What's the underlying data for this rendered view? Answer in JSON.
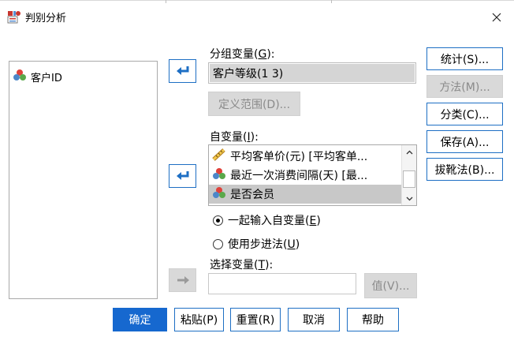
{
  "dialog": {
    "title": "判别分析"
  },
  "source_list": {
    "items": [
      {
        "label": "客户ID",
        "icon": "nominal-variable-icon"
      }
    ]
  },
  "grouping": {
    "label_text": "分组变量(",
    "label_key": "G",
    "label_tail": "):",
    "value": "客户等级(1 3)",
    "define_range": "定义范围(D)..."
  },
  "independents": {
    "label_text": "自变量(",
    "label_key": "I",
    "label_tail": "):",
    "items": [
      {
        "label": "平均客单价(元) [平均客单...",
        "icon": "scale-variable-icon",
        "selected": false
      },
      {
        "label": "最近一次消费间隔(天) [最...",
        "icon": "nominal-variable-icon",
        "selected": false
      },
      {
        "label": "是否会员",
        "icon": "nominal-variable-icon",
        "selected": true
      }
    ]
  },
  "method_options": {
    "enter_together_text": "一起输入自变量(",
    "enter_together_key": "E",
    "enter_together_tail": ")",
    "stepwise_text": "使用步进法(",
    "stepwise_key": "U",
    "stepwise_tail": ")",
    "selected": "enter_together"
  },
  "selection": {
    "label_text": "选择变量(",
    "label_key": "T",
    "label_tail": "):",
    "value_button": "值(V)..."
  },
  "side_buttons": {
    "statistics": "统计(S)...",
    "method": "方法(M)...",
    "classify": "分类(C)...",
    "save": "保存(A)...",
    "bootstrap": "拔靴法(B)..."
  },
  "bottom_buttons": {
    "ok": "确定",
    "paste": "粘贴(P)",
    "reset": "重置(R)",
    "cancel": "取消",
    "help": "帮助"
  },
  "colors": {
    "accent": "#1668cf",
    "disabled_bg": "#d9d9d9",
    "selection_bg": "#c8c8c8"
  }
}
